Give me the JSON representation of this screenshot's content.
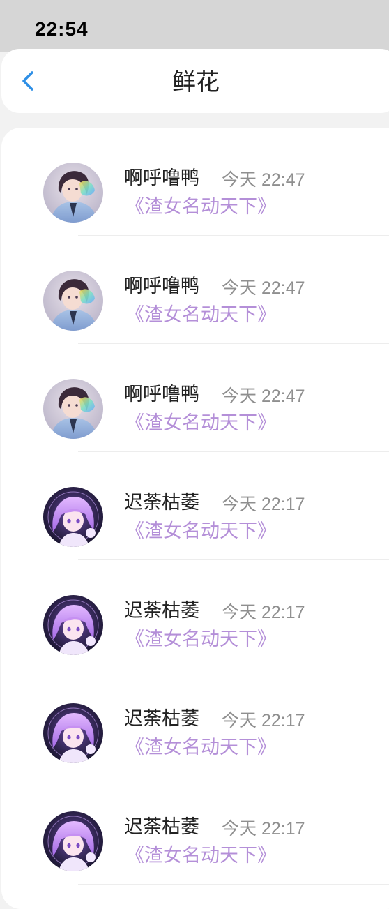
{
  "status_bar": {
    "time": "22:54"
  },
  "nav": {
    "title": "鲜花",
    "back_icon": "chevron-left-icon"
  },
  "colors": {
    "back_icon": "#2e8fe6",
    "book_title": "#b48fd8",
    "time": "#8f8f8f"
  },
  "items": [
    {
      "user": "啊呼噜鸭",
      "time": "今天 22:47",
      "book": "《渣女名动天下》",
      "avatar": "avatar-boy"
    },
    {
      "user": "啊呼噜鸭",
      "time": "今天 22:47",
      "book": "《渣女名动天下》",
      "avatar": "avatar-boy"
    },
    {
      "user": "啊呼噜鸭",
      "time": "今天 22:47",
      "book": "《渣女名动天下》",
      "avatar": "avatar-boy"
    },
    {
      "user": "迟荼枯萎",
      "time": "今天 22:17",
      "book": "《渣女名动天下》",
      "avatar": "avatar-purple-girl"
    },
    {
      "user": "迟荼枯萎",
      "time": "今天 22:17",
      "book": "《渣女名动天下》",
      "avatar": "avatar-purple-girl"
    },
    {
      "user": "迟荼枯萎",
      "time": "今天 22:17",
      "book": "《渣女名动天下》",
      "avatar": "avatar-purple-girl"
    },
    {
      "user": "迟荼枯萎",
      "time": "今天 22:17",
      "book": "《渣女名动天下》",
      "avatar": "avatar-purple-girl"
    }
  ]
}
